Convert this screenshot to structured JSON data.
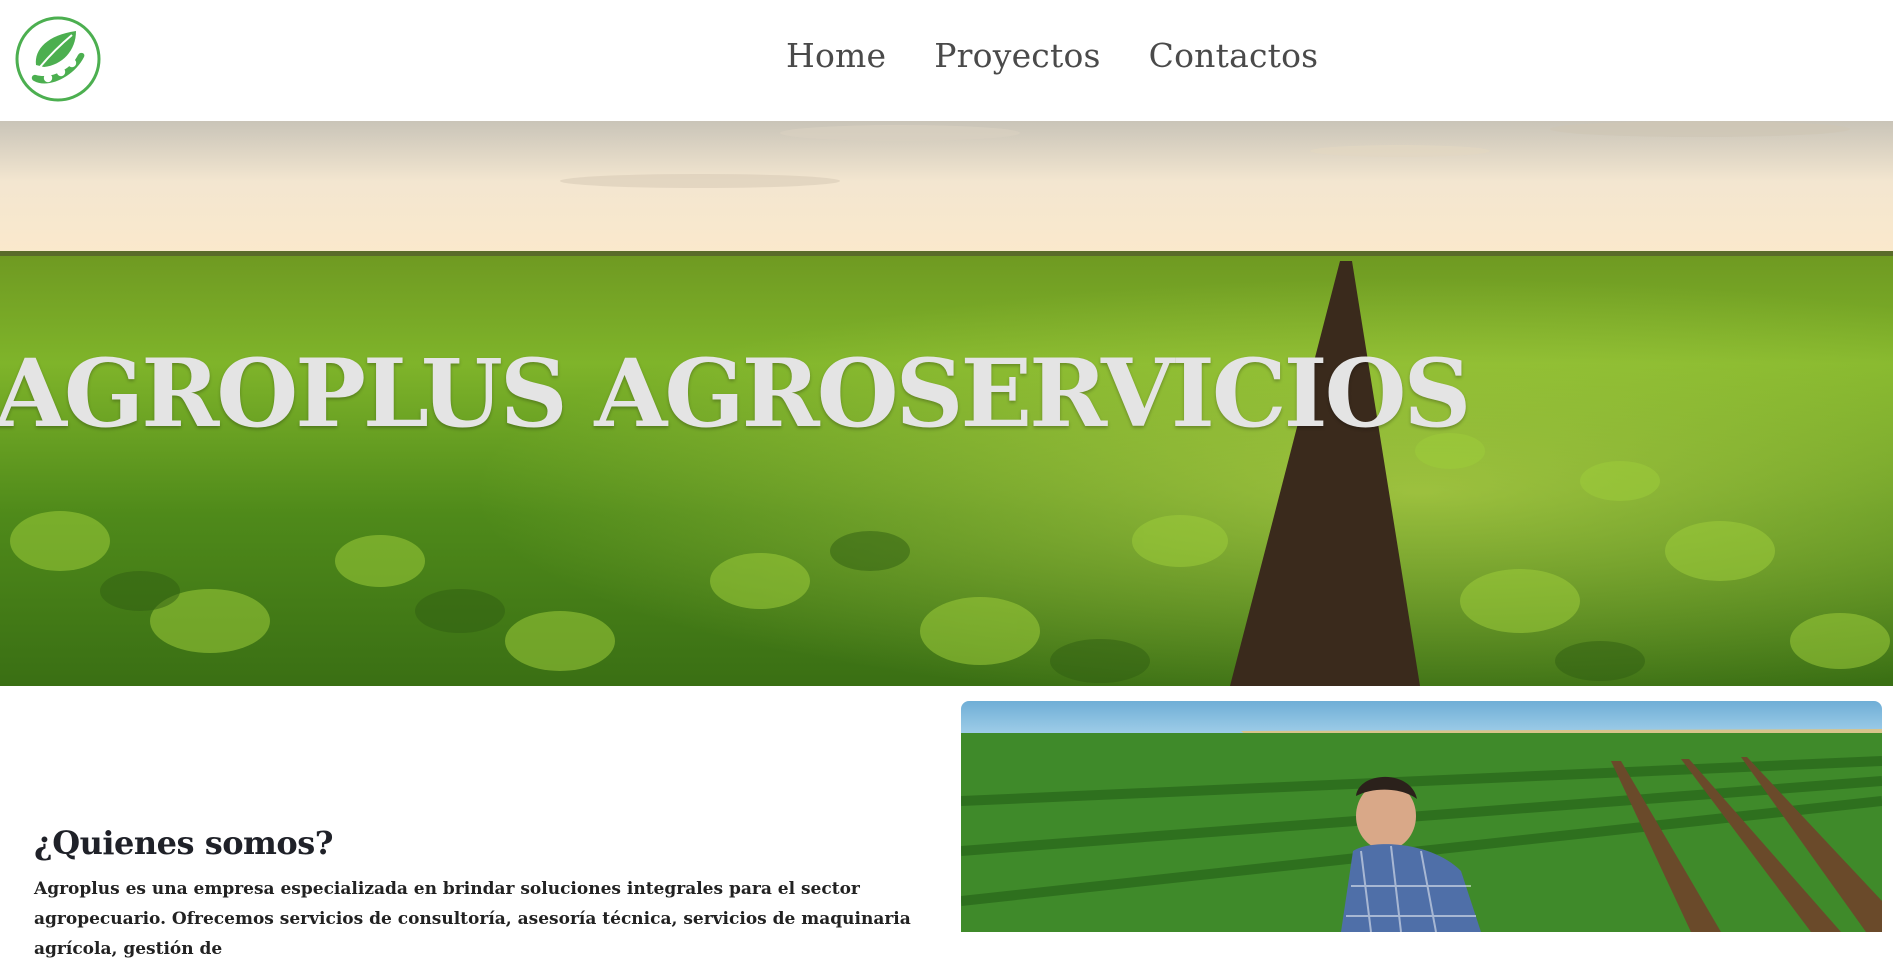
{
  "brand": {
    "logo_icon": "leaf-seed-logo-icon",
    "logo_color": "#4caf50"
  },
  "nav": {
    "items": [
      {
        "label": "Home"
      },
      {
        "label": "Proyectos"
      },
      {
        "label": "Contactos"
      }
    ]
  },
  "hero": {
    "title": "AGROPLUS AGROSERVICIOS"
  },
  "about": {
    "title": "¿Quienes somos?",
    "body": "Agroplus es una empresa especializada en brindar soluciones integrales para el sector agropecuario. Ofrecemos servicios de consultoría, asesoría técnica, servicios de maquinaria agrícola, gestión de"
  },
  "colors": {
    "accent": "#4caf50",
    "nav_text": "#4a4a4a",
    "heading_text": "#1f2128"
  }
}
